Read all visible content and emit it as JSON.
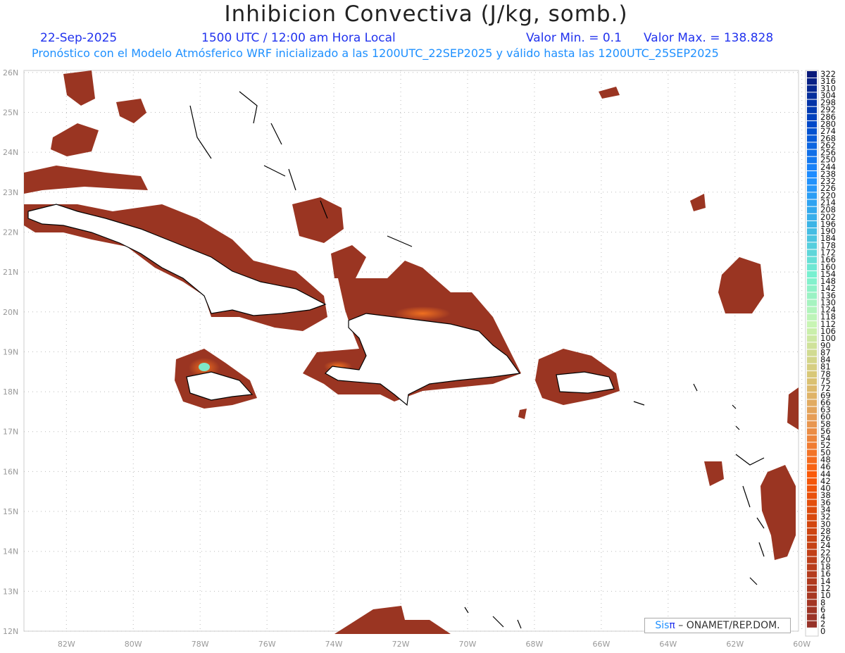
{
  "header": {
    "title": "Inhibicion Convectiva (J/kg, somb.)",
    "date": "22-Sep-2025",
    "time": "1500 UTC / 12:00 am Hora Local",
    "min": "Valor Min. = 0.1",
    "max": "Valor Max. = 138.828",
    "subtitle": "Pronóstico con el Modelo Atmósferico WRF inicializado a las 1200UTC_22SEP2025 y válido hasta las  1200UTC_25SEP2025"
  },
  "map": {
    "lon_range": [
      -83.27,
      -60.1
    ],
    "lat_range": [
      12,
      26.05
    ],
    "lon_ticks": [
      {
        "v": -82,
        "l": "82W"
      },
      {
        "v": -80,
        "l": "80W"
      },
      {
        "v": -78,
        "l": "78W"
      },
      {
        "v": -76,
        "l": "76W"
      },
      {
        "v": -74,
        "l": "74W"
      },
      {
        "v": -72,
        "l": "72W"
      },
      {
        "v": -70,
        "l": "70W"
      },
      {
        "v": -68,
        "l": "68W"
      },
      {
        "v": -66,
        "l": "66W"
      },
      {
        "v": -64,
        "l": "64W"
      },
      {
        "v": -62,
        "l": "62W"
      },
      {
        "v": -60,
        "l": "60W"
      }
    ],
    "lat_ticks": [
      {
        "v": 12,
        "l": "12N"
      },
      {
        "v": 13,
        "l": "13N"
      },
      {
        "v": 14,
        "l": "14N"
      },
      {
        "v": 15,
        "l": "15N"
      },
      {
        "v": 16,
        "l": "16N"
      },
      {
        "v": 17,
        "l": "17N"
      },
      {
        "v": 18,
        "l": "18N"
      },
      {
        "v": 19,
        "l": "19N"
      },
      {
        "v": 20,
        "l": "20N"
      },
      {
        "v": 21,
        "l": "21N"
      },
      {
        "v": 22,
        "l": "22N"
      },
      {
        "v": 23,
        "l": "23N"
      },
      {
        "v": 24,
        "l": "24N"
      },
      {
        "v": 25,
        "l": "25N"
      },
      {
        "v": 26,
        "l": "26N"
      }
    ]
  },
  "colorbar": {
    "labels": [
      "322",
      "316",
      "310",
      "304",
      "298",
      "292",
      "286",
      "280",
      "274",
      "268",
      "262",
      "256",
      "250",
      "244",
      "238",
      "232",
      "226",
      "220",
      "214",
      "208",
      "202",
      "196",
      "190",
      "184",
      "178",
      "172",
      "166",
      "160",
      "154",
      "148",
      "142",
      "136",
      "130",
      "124",
      "118",
      "112",
      "106",
      "100",
      "90",
      "87",
      "84",
      "81",
      "78",
      "75",
      "72",
      "69",
      "66",
      "63",
      "60",
      "58",
      "56",
      "54",
      "52",
      "50",
      "48",
      "46",
      "44",
      "42",
      "40",
      "38",
      "36",
      "34",
      "32",
      "30",
      "28",
      "26",
      "24",
      "22",
      "20",
      "18",
      "16",
      "14",
      "12",
      "10",
      "8",
      "6",
      "4",
      "2",
      "0"
    ],
    "stops": [
      "#0a1a7a",
      "#0048c8",
      "#1e8cff",
      "#3cb4e6",
      "#78f0d0",
      "#c8f5b4",
      "#d8c878",
      "#e89650",
      "#fa5a0a",
      "#d2460f",
      "#b43c1e",
      "#963228"
    ]
  },
  "credit": {
    "brand_a": "Sis",
    "brand_b": "π",
    "text": " –  ONAMET/REP.DOM."
  },
  "colors": {
    "field": "#9a3522",
    "field_edge": "#c8501a",
    "coast": "#000000"
  }
}
